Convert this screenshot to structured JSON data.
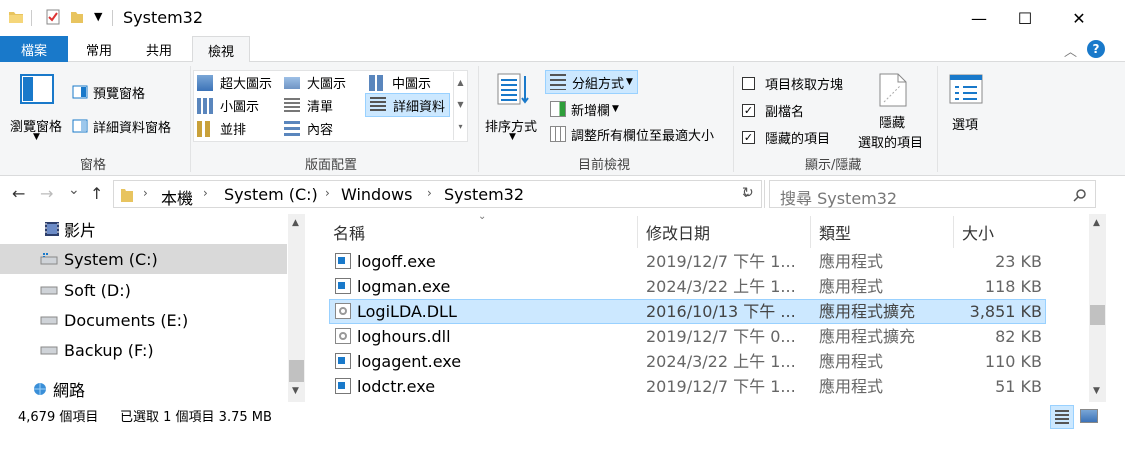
{
  "window": {
    "title": "System32",
    "minimize_glyph": "—",
    "maximize_glyph": "☐",
    "close_glyph": "✕"
  },
  "tabs": [
    "檔案",
    "常用",
    "共用",
    "檢視"
  ],
  "help_glyph": "?",
  "ribbon": {
    "panes": {
      "nav_pane": "瀏覽窗格",
      "preview_pane": "預覽窗格",
      "details_pane": "詳細資料窗格",
      "group_label": "窗格"
    },
    "layout": {
      "xl_icons": "超大圖示",
      "l_icons": "大圖示",
      "m_icons": "中圖示",
      "s_icons": "小圖示",
      "list": "清單",
      "details": "詳細資料",
      "tiles": "並排",
      "content": "內容",
      "group_label": "版面配置"
    },
    "current_view": {
      "sort_by": "排序方式",
      "group_by": "分組方式",
      "add_columns": "新增欄",
      "size_columns": "調整所有欄位至最適大小",
      "group_label": "目前檢視"
    },
    "show_hide": {
      "item_check_boxes": "項目核取方塊",
      "item_check_boxes_checked": false,
      "file_name_extensions": "副檔名",
      "file_name_extensions_checked": true,
      "hidden_items": "隱藏的項目",
      "hidden_items_checked": true,
      "hide_selected_line1": "隱藏",
      "hide_selected_line2": "選取的項目",
      "group_label": "顯示/隱藏"
    },
    "options": "選項"
  },
  "nav": {
    "back": "←",
    "forward": "→",
    "recent": "⌄",
    "up": "↑",
    "breadcrumb": [
      "本機",
      "System (C:)",
      "Windows",
      "System32"
    ],
    "search_placeholder": "搜尋 System32"
  },
  "sidebar": {
    "items": [
      {
        "label": "影片"
      },
      {
        "label": "System (C:)"
      },
      {
        "label": "Soft (D:)"
      },
      {
        "label": "Documents (E:)"
      },
      {
        "label": "Backup (F:)"
      },
      {
        "label": "網路"
      }
    ]
  },
  "list": {
    "headers": {
      "name": "名稱",
      "date": "修改日期",
      "type": "類型",
      "size": "大小"
    },
    "rows": [
      {
        "name": "logoff.exe",
        "date": "2019/12/7 下午 1...",
        "type": "應用程式",
        "size": "23 KB",
        "kind": "exe"
      },
      {
        "name": "logman.exe",
        "date": "2024/3/22 上午 1...",
        "type": "應用程式",
        "size": "118 KB",
        "kind": "exe"
      },
      {
        "name": "LogiLDA.DLL",
        "date": "2016/10/13 下午 ...",
        "type": "應用程式擴充",
        "size": "3,851 KB",
        "kind": "dll"
      },
      {
        "name": "loghours.dll",
        "date": "2019/12/7 下午 0...",
        "type": "應用程式擴充",
        "size": "82 KB",
        "kind": "dll"
      },
      {
        "name": "logagent.exe",
        "date": "2024/3/22 上午 1...",
        "type": "應用程式",
        "size": "110 KB",
        "kind": "exe"
      },
      {
        "name": "lodctr.exe",
        "date": "2019/12/7 下午 1...",
        "type": "應用程式",
        "size": "51 KB",
        "kind": "exe"
      }
    ],
    "selected_index": 2
  },
  "status": {
    "item_count": "4,679 個項目",
    "selection": "已選取 1 個項目  3.75 MB"
  },
  "colors": {
    "accent": "#1979ca",
    "selection_bg": "#cce8ff",
    "selection_border": "#99d1ff",
    "sidebar_selected": "#d9d9d9"
  }
}
